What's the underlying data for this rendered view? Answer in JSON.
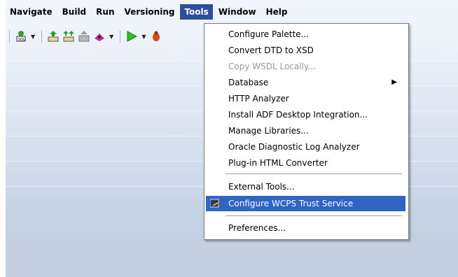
{
  "menubar": {
    "items": [
      {
        "label": "Navigate"
      },
      {
        "label": "Build"
      },
      {
        "label": "Run"
      },
      {
        "label": "Versioning"
      },
      {
        "label": "Tools",
        "active": true
      },
      {
        "label": "Window"
      },
      {
        "label": "Help"
      }
    ]
  },
  "toolbar": {
    "icons": [
      "sql-worksheet-icon",
      "make-icon",
      "rebuild-icon",
      "deploy-icon",
      "debug-icon",
      "run-icon",
      "bug-icon"
    ]
  },
  "tools_menu": {
    "items": [
      {
        "label": "Configure Palette...",
        "enabled": true
      },
      {
        "label": "Convert DTD to XSD",
        "enabled": true
      },
      {
        "label": "Copy WSDL Locally...",
        "enabled": false
      },
      {
        "label": "Database",
        "enabled": true,
        "submenu": true
      },
      {
        "label": "HTTP Analyzer",
        "enabled": true
      },
      {
        "label": "Install ADF Desktop Integration...",
        "enabled": true
      },
      {
        "label": "Manage Libraries...",
        "enabled": true
      },
      {
        "label": "Oracle Diagnostic Log Analyzer",
        "enabled": true
      },
      {
        "label": "Plug-in HTML Converter",
        "enabled": true
      },
      {
        "label": "External Tools...",
        "enabled": true
      },
      {
        "label": "Configure WCPS Trust Service",
        "enabled": true,
        "highlighted": true
      },
      {
        "label": "Preferences...",
        "enabled": true
      }
    ]
  },
  "colors": {
    "highlight": "#3163c5",
    "active_menu": "#2f4e9a"
  }
}
